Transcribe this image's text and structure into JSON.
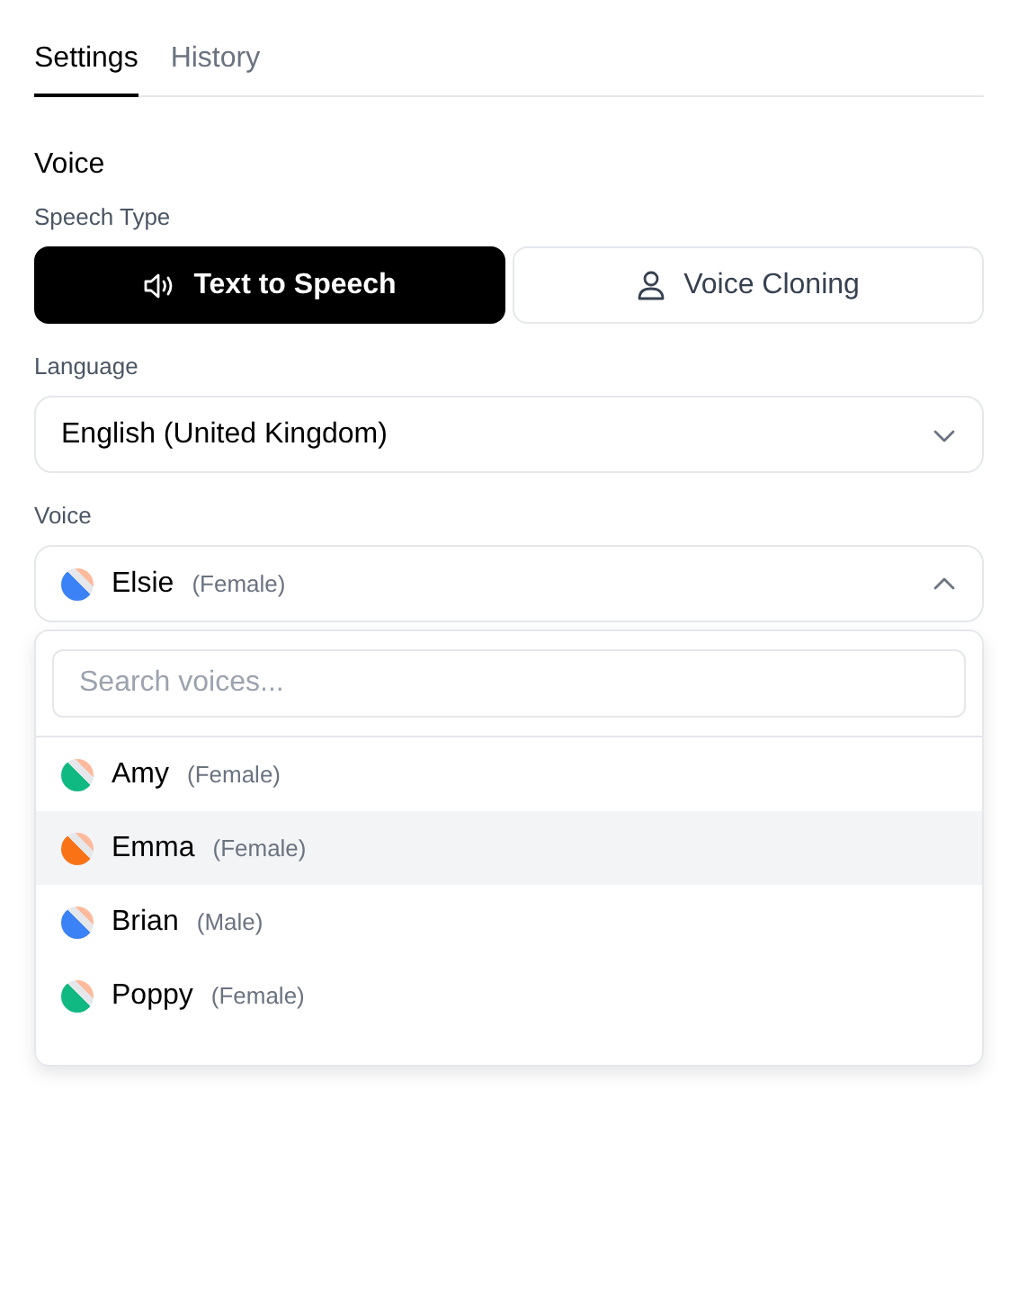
{
  "tabs": [
    {
      "label": "Settings",
      "selected": true
    },
    {
      "label": "History",
      "selected": false
    }
  ],
  "section_title": "Voice",
  "speech_type": {
    "label": "Speech Type",
    "options": [
      {
        "label": "Text to Speech",
        "kind": "speaker",
        "selected": true
      },
      {
        "label": "Voice Cloning",
        "kind": "person",
        "selected": false
      }
    ]
  },
  "language": {
    "label": "Language",
    "value": "English (United Kingdom)",
    "expanded": false
  },
  "voice": {
    "label": "Voice",
    "name": "Elsie",
    "gender": "(Female)",
    "color": "#3b82f6",
    "expanded": true
  },
  "dropdown": {
    "search": {
      "placeholder": "Search voices..."
    },
    "voices": [
      {
        "name": "Amy",
        "gender": "(Female)",
        "color": "#10b981",
        "highlighted": false
      },
      {
        "name": "Emma",
        "gender": "(Female)",
        "color": "#f97316",
        "highlighted": true
      },
      {
        "name": "Brian",
        "gender": "(Male)",
        "color": "#3b82f6",
        "highlighted": false
      },
      {
        "name": "Poppy",
        "gender": "(Female)",
        "color": "#10b981",
        "highlighted": false
      }
    ]
  }
}
